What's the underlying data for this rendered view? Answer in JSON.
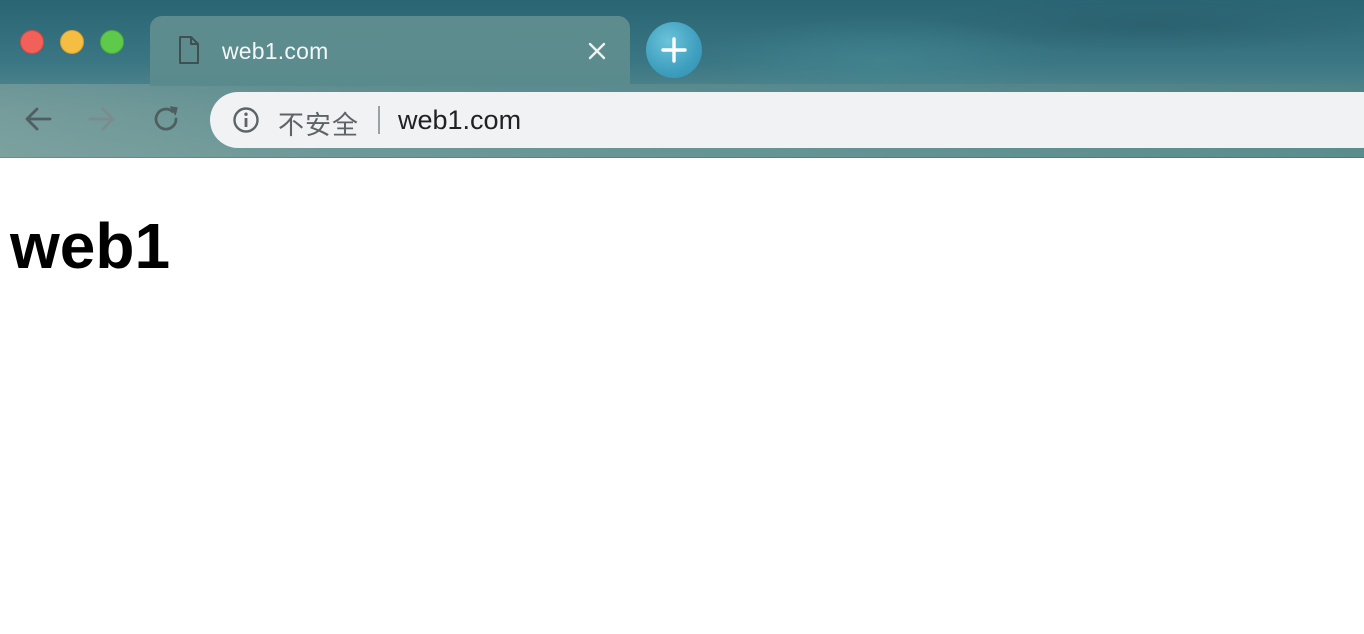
{
  "window": {
    "traffic_lights": {
      "close_color": "#f2605a",
      "minimize_color": "#f5bd42",
      "maximize_color": "#5fc94c"
    }
  },
  "tab": {
    "title": "web1.com",
    "icon": "document-icon",
    "close_icon": "close-icon"
  },
  "new_tab": {
    "icon": "plus-icon",
    "color": "#3e9fbe"
  },
  "toolbar": {
    "back_icon": "arrow-left-icon",
    "forward_icon": "arrow-right-icon",
    "reload_icon": "reload-icon"
  },
  "omnibox": {
    "info_icon": "info-icon",
    "security_label": "不安全",
    "url": "web1.com"
  },
  "page": {
    "heading": "web1"
  }
}
